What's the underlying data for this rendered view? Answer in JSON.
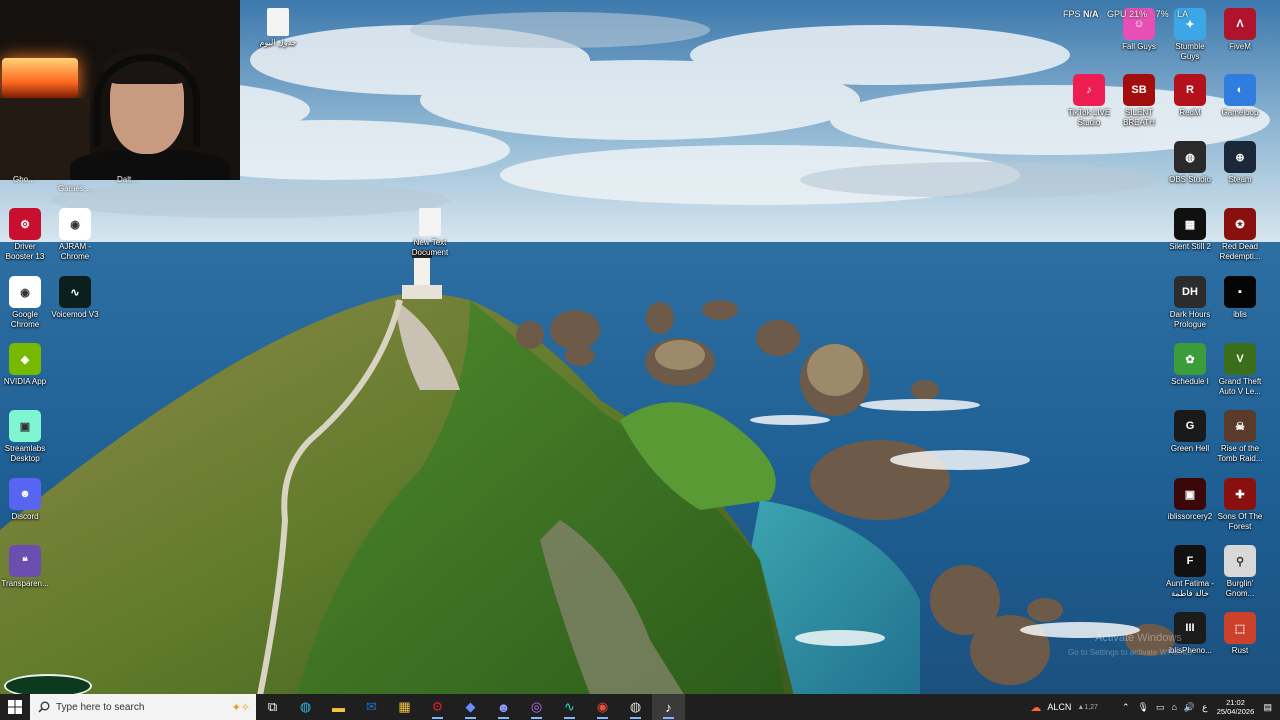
{
  "desktop": {
    "left_column": [
      {
        "label": "Driver Booster 13",
        "icon": "driver-booster-icon",
        "color": "#c8102e",
        "glyph": "⚙"
      },
      {
        "label": "AJRAM - Chrome",
        "icon": "chrome-icon",
        "color": "#ffffff",
        "glyph": "◉"
      },
      {
        "label": "Google Chrome",
        "icon": "chrome-icon",
        "color": "#ffffff",
        "glyph": "◉"
      },
      {
        "label": "Voicemod V3",
        "icon": "voicemod-icon",
        "color": "#0c1f1f",
        "glyph": "∿"
      },
      {
        "label": "NVIDIA App",
        "icon": "nvidia-icon",
        "color": "#76b900",
        "glyph": "◈"
      },
      {
        "label": "Streamlabs Desktop",
        "icon": "streamlabs-icon",
        "color": "#80f5d2",
        "glyph": "▣"
      },
      {
        "label": "Discord",
        "icon": "discord-icon",
        "color": "#5865f2",
        "glyph": "☻"
      },
      {
        "label": "Transparen...",
        "icon": "chat-bubble-icon",
        "color": "#6a4fb0",
        "glyph": "❝"
      }
    ],
    "file_top": {
      "label": "جدول اليوم",
      "icon": "text-file-icon"
    },
    "file_center": {
      "label": "New Text Document",
      "icon": "text-file-icon"
    },
    "hidden_labels": [
      "Gho...",
      "Games ...",
      "Dalt..."
    ],
    "right_column": [
      {
        "label": "Fall Guys",
        "icon": "fall-guys-icon",
        "color": "#e64fb4",
        "glyph": "☺"
      },
      {
        "label": "Stumble Guys",
        "icon": "stumble-guys-icon",
        "color": "#3ca7e6",
        "glyph": "✦"
      },
      {
        "label": "FiveM",
        "icon": "fivem-icon",
        "color": "#b0142c",
        "glyph": "Λ"
      },
      {
        "label": "TikTok LIVE Studio",
        "icon": "tiktok-icon",
        "color": "#ee1d52",
        "glyph": "♪"
      },
      {
        "label": "SILENT BREATH",
        "icon": "silent-breath-icon",
        "color": "#a30d0d",
        "glyph": "SB"
      },
      {
        "label": "RedM",
        "icon": "redm-icon",
        "color": "#b3121c",
        "glyph": "R"
      },
      {
        "label": "Gameloop",
        "icon": "gameloop-icon",
        "color": "#2f7de1",
        "glyph": "◐"
      },
      {
        "label": "OBS Studio",
        "icon": "obs-icon",
        "color": "#2a2a2a",
        "glyph": "◍"
      },
      {
        "label": "Steam",
        "icon": "steam-icon",
        "color": "#1b2838",
        "glyph": "⊕"
      },
      {
        "label": "Silent Still 2",
        "icon": "silent-still-icon",
        "color": "#101010",
        "glyph": "▦"
      },
      {
        "label": "Red Dead Redempti...",
        "icon": "red-dead-icon",
        "color": "#8a1010",
        "glyph": "✪"
      },
      {
        "label": "Dark Hours Prologue",
        "icon": "dark-hours-icon",
        "color": "#2c2c2c",
        "glyph": "DH"
      },
      {
        "label": "iblis",
        "icon": "iblis-icon",
        "color": "#050505",
        "glyph": "▪"
      },
      {
        "label": "Schedule I",
        "icon": "schedule-icon",
        "color": "#3d9c3a",
        "glyph": "✿"
      },
      {
        "label": "Grand Theft Auto V Le...",
        "icon": "gta-icon",
        "color": "#3a6e1a",
        "glyph": "V"
      },
      {
        "label": "Green Hell",
        "icon": "green-hell-icon",
        "color": "#1a1a1a",
        "glyph": "G"
      },
      {
        "label": "Rise of the Tomb Raid...",
        "icon": "tomb-raider-icon",
        "color": "#5a3a2a",
        "glyph": "☠"
      },
      {
        "label": "iblissorcery2",
        "icon": "iblis-sorcery-icon",
        "color": "#3a0808",
        "glyph": "▣"
      },
      {
        "label": "Sons Of The Forest",
        "icon": "sons-forest-icon",
        "color": "#8a1010",
        "glyph": "✚"
      },
      {
        "label": "Aunt Fatima - خالة فاطمة",
        "icon": "aunt-fatima-icon",
        "color": "#111111",
        "glyph": "F"
      },
      {
        "label": "Burglin' Gnom...",
        "icon": "gnome-icon",
        "color": "#d8d8d8",
        "glyph": "⚲"
      },
      {
        "label": "iblisPheno...",
        "icon": "iblis-pheno-icon",
        "color": "#1c1c1c",
        "glyph": "III"
      },
      {
        "label": "Rust",
        "icon": "rust-icon",
        "color": "#cd412b",
        "glyph": "⬚"
      }
    ]
  },
  "overlay": {
    "fps_label": "FPS",
    "fps_value": "N/A",
    "gpu_label": "GPU",
    "gpu_value": "21%",
    "cpu_value": "7%",
    "lat_value": "LA"
  },
  "watermark": {
    "line1": "Activate Windows",
    "line2": "Go to Settings to activate Windows."
  },
  "taskbar": {
    "search_placeholder": "Type here to search",
    "apps": [
      {
        "icon": "task-view-icon",
        "glyph": "⧉",
        "color": "#ffffff"
      },
      {
        "icon": "edge-icon",
        "glyph": "◍",
        "color": "#2fb8e8"
      },
      {
        "icon": "file-explorer-icon",
        "glyph": "▬",
        "color": "#f3c33b"
      },
      {
        "icon": "outlook-icon",
        "glyph": "✉",
        "color": "#1f6fd1"
      },
      {
        "icon": "store-icon",
        "glyph": "▦",
        "color": "#f3c33b"
      },
      {
        "icon": "driver-booster-icon",
        "glyph": "⚙",
        "color": "#d41f2f"
      },
      {
        "icon": "streamlabs-icon",
        "glyph": "◆",
        "color": "#6b8cff"
      },
      {
        "icon": "discord-icon",
        "glyph": "☻",
        "color": "#8f9bff"
      },
      {
        "icon": "messenger-icon",
        "glyph": "◎",
        "color": "#c46bff"
      },
      {
        "icon": "voicemod-icon",
        "glyph": "∿",
        "color": "#20e0c0"
      },
      {
        "icon": "chrome-icon",
        "glyph": "◉",
        "color": "#e84b3c"
      },
      {
        "icon": "obs-icon",
        "glyph": "◍",
        "color": "#dddddd"
      },
      {
        "icon": "tiktok-icon",
        "glyph": "♪",
        "color": "#ffffff"
      }
    ],
    "tray": {
      "weather": "ALCN",
      "weather_value": "▲1,27",
      "time": "21:02",
      "date": "25/04/2026"
    }
  }
}
